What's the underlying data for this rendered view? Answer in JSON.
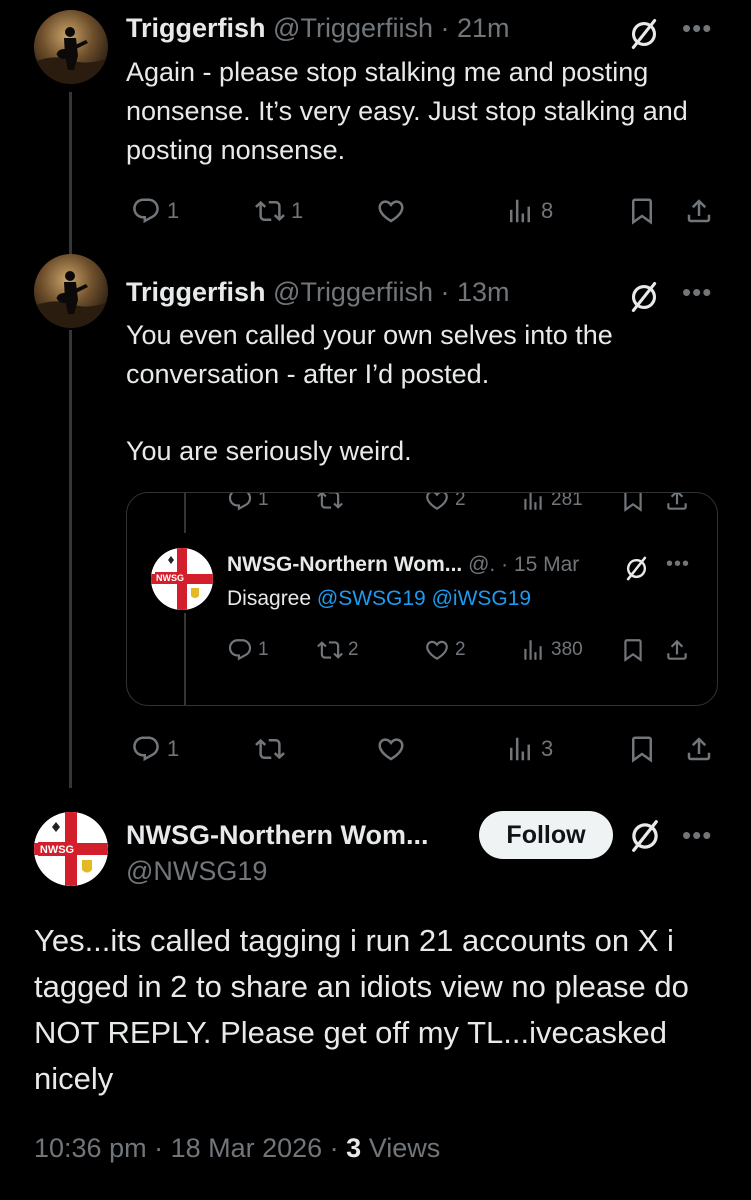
{
  "tweet1": {
    "name": "Triggerfish",
    "handle": "@Triggerfiish",
    "time": "· 21m",
    "text": "Again - please stop stalking me and posting nonsense. It’s very easy. Just stop stalking and posting nonsense.",
    "replies": "1",
    "reposts": "1",
    "likes": "",
    "views": "8"
  },
  "tweet2": {
    "name": "Triggerfish",
    "handle": "@Triggerfiish",
    "time": "· 13m",
    "text_line1": "You even called your own selves into the",
    "text_line2": "conversation - after I’d posted.",
    "text_line3": "You are seriously weird.",
    "replies": "1",
    "reposts": "",
    "likes": "",
    "views": "3"
  },
  "quote": {
    "top_actions": {
      "replies": "1",
      "reposts": "",
      "likes": "2",
      "views": "281"
    },
    "name": "NWSG-Northern Wom...",
    "handle": "@.",
    "time": "· 15 Mar",
    "text_prefix": "Disagree",
    "mention1": "@SWSG19",
    "mention2": "@iWSG19",
    "avatar_label": "NWSG",
    "actions": {
      "replies": "1",
      "reposts": "2",
      "likes": "2",
      "views": "380"
    }
  },
  "main": {
    "name": "NWSG-Northern Wom...",
    "handle": "@NWSG19",
    "avatar_label": "NWSG",
    "follow_label": "Follow",
    "text": "Yes...its called tagging i run 21 accounts on X i tagged in 2 to share an idiots view no please do NOT REPLY. Please get off my TL...ivecasked nicely",
    "footer_time": "10:36 pm · 18 Mar 2026 · ",
    "footer_views_count": "3",
    "footer_views_label": " Views"
  },
  "colors": {
    "background": "#000000",
    "text": "#e7e9ea",
    "muted": "#71767b",
    "link": "#1d9bf0",
    "follow_bg": "#eff3f4"
  }
}
